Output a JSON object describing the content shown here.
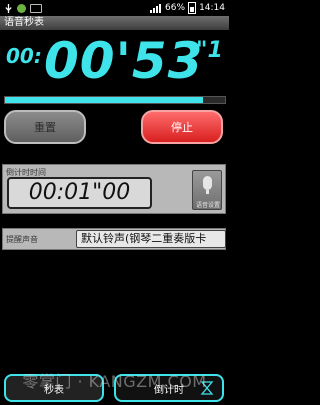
{
  "status_bar": {
    "battery_percent": "66%",
    "time": "14:14",
    "icons": [
      "usb-icon",
      "app-icon",
      "notification-icon",
      "signal-icon",
      "battery-icon"
    ]
  },
  "app": {
    "title": "语音秒表"
  },
  "timer": {
    "hours": "00:",
    "main": "00'53",
    "fraction": "\"1"
  },
  "progress": {
    "fraction": 0.9
  },
  "buttons": {
    "reset": "重置",
    "stop": "停止"
  },
  "countdown": {
    "label": "倒计时时间",
    "value": "00:01\"00",
    "voice_label": "语音设置"
  },
  "ring": {
    "label": "提醒声音",
    "value": "默认铃声(钢琴二重奏版卡"
  },
  "tabs": {
    "stopwatch": "秒表",
    "countdown": "倒计时"
  },
  "watermark": "零掌门 · KANGZM.COM",
  "colors": {
    "accent": "#3fe3ea",
    "stop": "#e62a2a",
    "panel": "#b8b8b8"
  }
}
